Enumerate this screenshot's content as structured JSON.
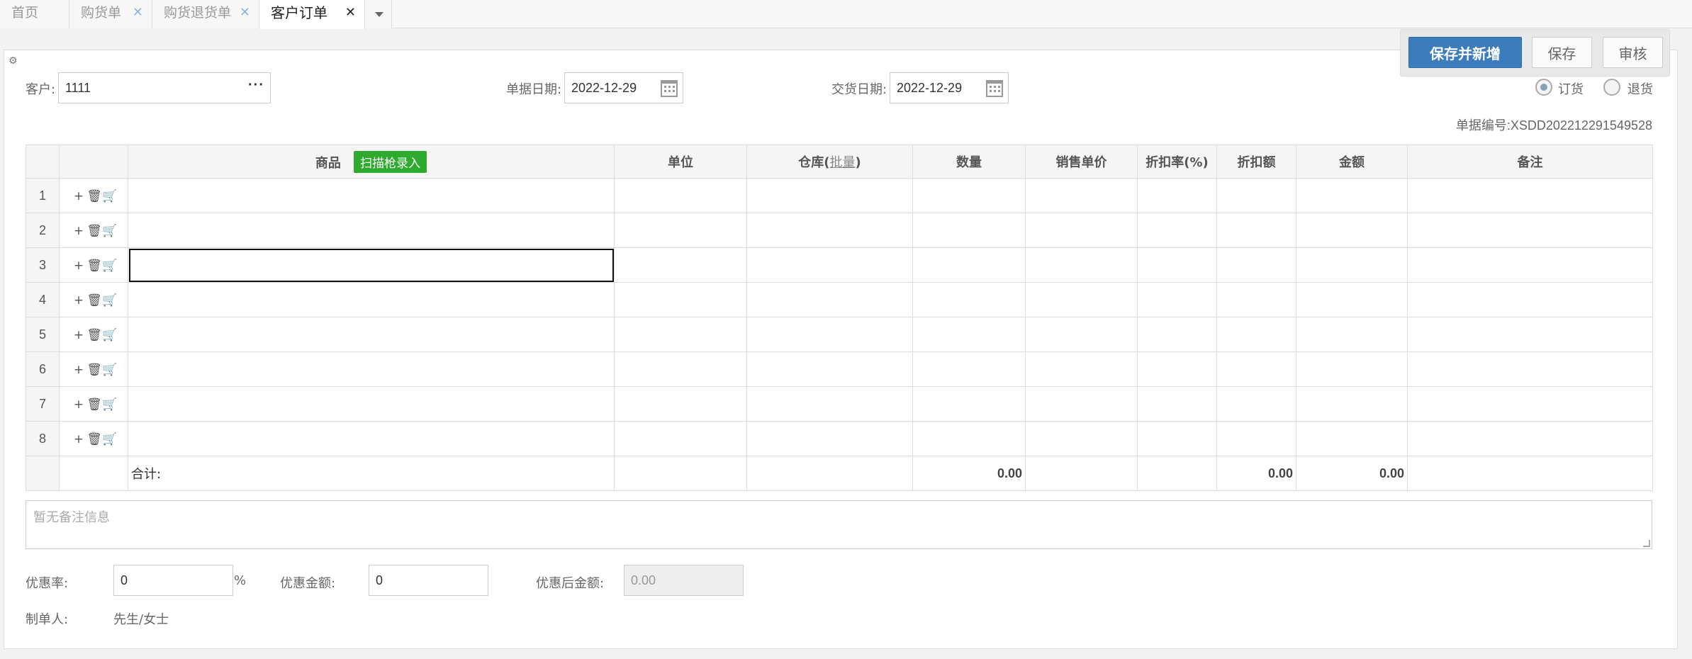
{
  "tabs": [
    {
      "label": "首页",
      "closable": false
    },
    {
      "label": "购货单",
      "closable": true
    },
    {
      "label": "购货退货单",
      "closable": true
    },
    {
      "label": "客户订单",
      "closable": true,
      "active": true
    }
  ],
  "toolbar": {
    "save_new_label": "保存并新增",
    "save_label": "保存",
    "audit_label": "审核"
  },
  "form": {
    "customer_label": "客户:",
    "customer_value": "1111",
    "bill_date_label": "单据日期:",
    "bill_date_value": "2022-12-29",
    "delivery_date_label": "交货日期:",
    "delivery_date_value": "2022-12-29",
    "order_type_options": [
      "订货",
      "退货"
    ],
    "order_type_selected": "订货",
    "order_no": "单据编号:XSDD202212291549528"
  },
  "grid": {
    "headers": {
      "product": "商品",
      "scan_button": "扫描枪录入",
      "unit": "单位",
      "warehouse": "仓库(",
      "batch": "批量",
      "warehouse_close": ")",
      "quantity": "数量",
      "unit_price": "销售单价",
      "discount_rate": "折扣率(%)",
      "discount_amount": "折扣额",
      "amount": "金额",
      "remark": "备注"
    },
    "row_numbers": [
      "1",
      "2",
      "3",
      "4",
      "5",
      "6",
      "7",
      "8"
    ],
    "focused_row": 3,
    "summary": {
      "label": "合计:",
      "quantity": "0.00",
      "discount_amount": "0.00",
      "amount": "0.00"
    }
  },
  "remark": {
    "placeholder": "暂无备注信息"
  },
  "footer": {
    "discount_rate_label": "优惠率:",
    "discount_rate_value": "0",
    "percent_sign": "%",
    "discount_amount_label": "优惠金额:",
    "discount_amount_value": "0",
    "after_discount_label": "优惠后金额:",
    "after_discount_value": "0.00",
    "creator_label": "制单人:",
    "creator_value": "先生/女士"
  },
  "colors": {
    "primary_button": "#3b7cbc",
    "scan_button": "#2eaa2e",
    "tab_close": "#8fb3d9"
  },
  "icons": [
    "settings-icon",
    "ellipsis-icon",
    "calendar-icon",
    "plus-icon",
    "trash-icon",
    "cart-icon",
    "caret-down-icon",
    "close-icon"
  ]
}
